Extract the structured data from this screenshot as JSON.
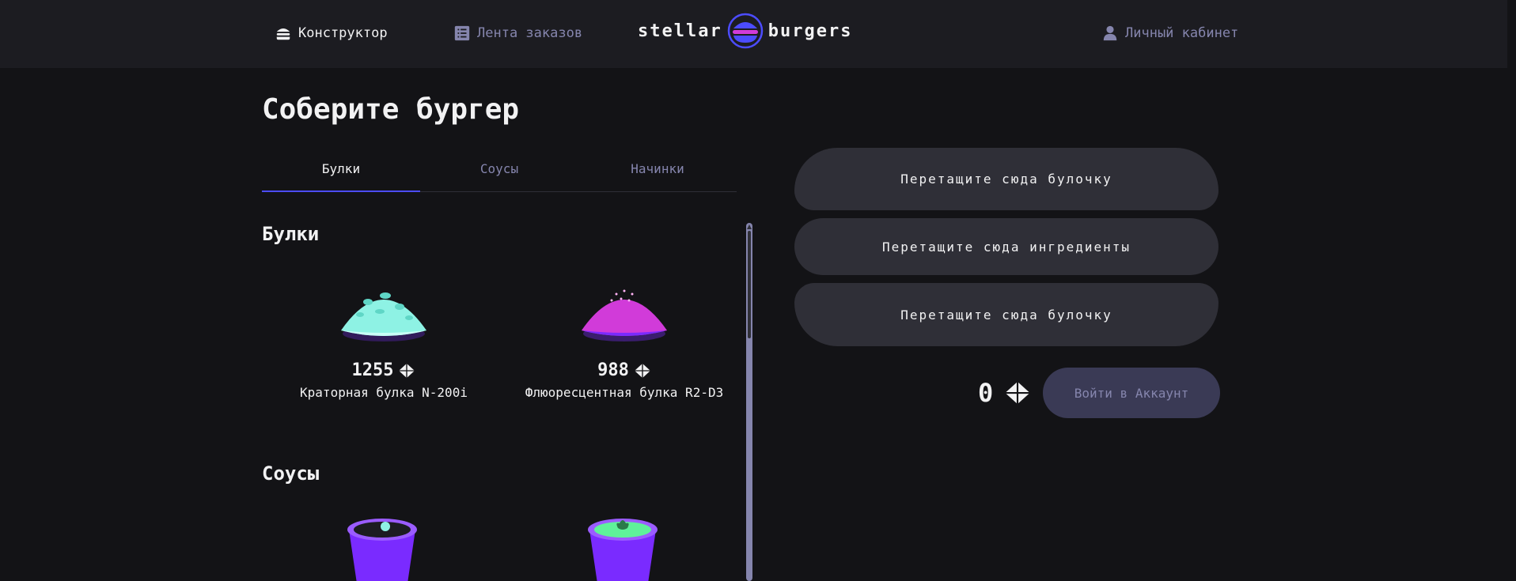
{
  "nav": {
    "constructor_label": "Конструктор",
    "feed_label": "Лента заказов",
    "account_label": "Личный кабинет"
  },
  "logo": {
    "left": "stellar",
    "right": "burgers"
  },
  "page_title": "Соберите бургер",
  "tabs": [
    {
      "label": "Булки",
      "active": true
    },
    {
      "label": "Соусы",
      "active": false
    },
    {
      "label": "Начинки",
      "active": false
    }
  ],
  "sections": {
    "buns": {
      "title": "Булки",
      "items": [
        {
          "price": "1255",
          "name": "Краторная булка N-200i",
          "color": "#7fe6d8"
        },
        {
          "price": "988",
          "name": "Флюоресцентная булка R2-D3",
          "color": "#d13bd9"
        }
      ]
    },
    "sauces": {
      "title": "Соусы"
    }
  },
  "constructor": {
    "top_bun_placeholder": "Перетащите сюда булочку",
    "ingredients_placeholder": "Перетащите сюда ингредиенты",
    "bottom_bun_placeholder": "Перетащите сюда булочку",
    "total": "0",
    "login_button": "Войти в Аккаунт"
  },
  "colors": {
    "background": "#131316",
    "header": "#1c1c21",
    "accent": "#4c4cff",
    "inactive_text": "#8585ad",
    "panel": "#2f2f37"
  }
}
